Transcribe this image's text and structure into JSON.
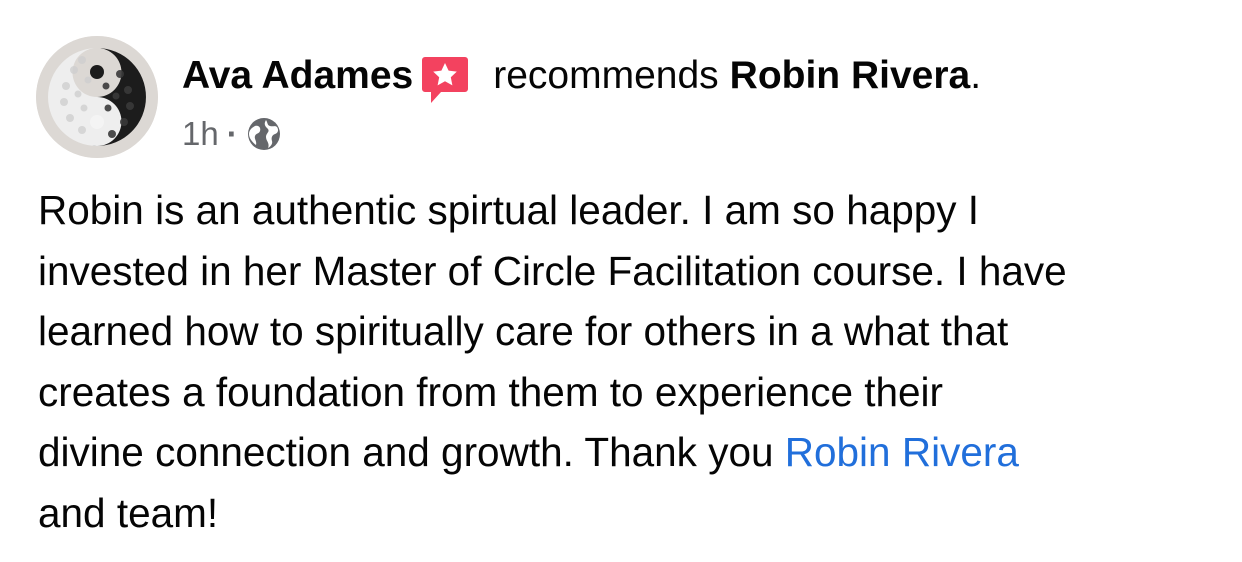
{
  "post": {
    "author": "Ava Adames",
    "verb": "recommends",
    "subject": "Robin Rivera",
    "subject_suffix": ".",
    "timestamp": "1h",
    "separator": "·",
    "privacy_icon": "globe-icon",
    "recommend_icon": "recommendation-star-icon",
    "body_lines": [
      "Robin is an authentic spirtual leader. I am so happy I",
      "invested in her Master of Circle Facilitation course. I have",
      "learned how to spiritually care for others in a what that",
      "creates a foundation from them to experience their",
      "divine connection and growth. Thank you "
    ],
    "mention": "Robin Rivera",
    "last_line": "and team!"
  },
  "colors": {
    "text": "#050505",
    "secondary_text": "#65676b",
    "link": "#216fdb",
    "recommend_badge": "#f3425f"
  }
}
